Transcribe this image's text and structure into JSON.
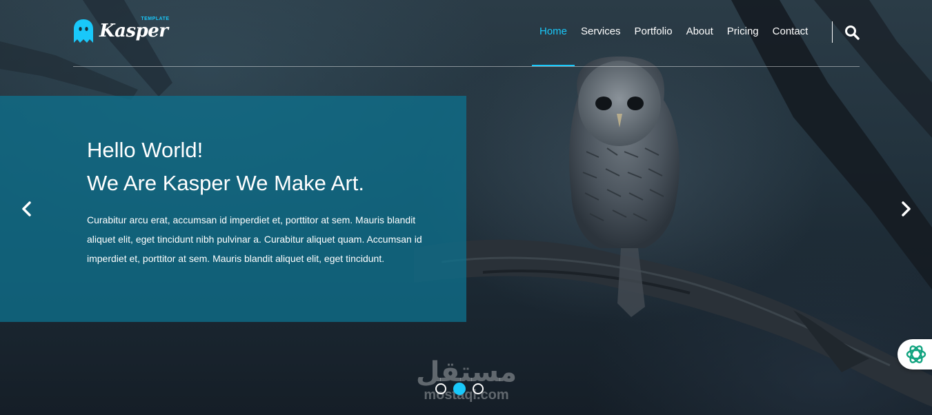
{
  "brand": {
    "name": "Kasper",
    "tagline": "TEMPLATE",
    "accent_color": "#19c8fa",
    "logo_icon": "ghost-icon"
  },
  "nav": {
    "items": [
      {
        "label": "Home",
        "active": true
      },
      {
        "label": "Services",
        "active": false
      },
      {
        "label": "Portfolio",
        "active": false
      },
      {
        "label": "About",
        "active": false
      },
      {
        "label": "Pricing",
        "active": false
      },
      {
        "label": "Contact",
        "active": false
      }
    ],
    "search_icon": "search-icon"
  },
  "hero": {
    "heading_line1": "Hello World!",
    "heading_line2": "We Are Kasper We Make Art.",
    "body": "Curabitur arcu erat, accumsan id imperdiet et, porttitor at sem. Mauris blandit aliquet elit, eget tincidunt nibh pulvinar a. Curabitur aliquet quam. Accumsan id imperdiet et, porttitor at sem. Mauris blandit aliquet elit, eget tincidunt.",
    "panel_color": "#0e708c",
    "prev_icon": "chevron-left-icon",
    "next_icon": "chevron-right-icon"
  },
  "slider": {
    "dot_count": 3,
    "active_index": 1
  },
  "watermark": {
    "arabic": "مستقل",
    "latin": "mostaql.com"
  },
  "floating_badge": {
    "icon": "openai-logo-icon"
  }
}
